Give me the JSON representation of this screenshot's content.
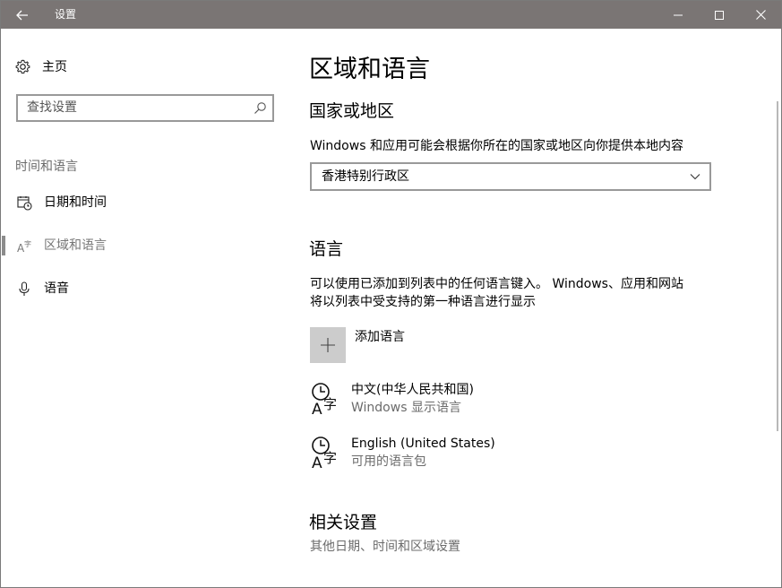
{
  "window": {
    "title": "设置"
  },
  "sidebar": {
    "home_label": "主页",
    "search_placeholder": "查找设置",
    "section_header": "时间和语言",
    "items": [
      {
        "label": "日期和时间",
        "icon": "calendar-clock-icon",
        "selected": false
      },
      {
        "label": "区域和语言",
        "icon": "region-language-icon",
        "selected": true
      },
      {
        "label": "语音",
        "icon": "microphone-icon",
        "selected": false
      }
    ]
  },
  "main": {
    "page_title": "区域和语言",
    "country": {
      "heading": "国家或地区",
      "description": "Windows 和应用可能会根据你所在的国家或地区向你提供本地内容",
      "selected": "香港特别行政区"
    },
    "language": {
      "heading": "语言",
      "description_line1": "可以使用已添加到列表中的任何语言键入。 Windows、应用和网站",
      "description_line2": "将以列表中受支持的第一种语言进行显示",
      "add_label": "添加语言",
      "items": [
        {
          "name": "中文(中华人民共和国)",
          "status": "Windows 显示语言"
        },
        {
          "name": "English (United States)",
          "status": "可用的语言包"
        }
      ]
    },
    "related": {
      "heading": "相关设置",
      "link": "其他日期、时间和区域设置"
    }
  },
  "colors": {
    "titlebar": "#7a7574",
    "selection_bar": "#8c8c8c",
    "add_button": "#cccccc"
  }
}
